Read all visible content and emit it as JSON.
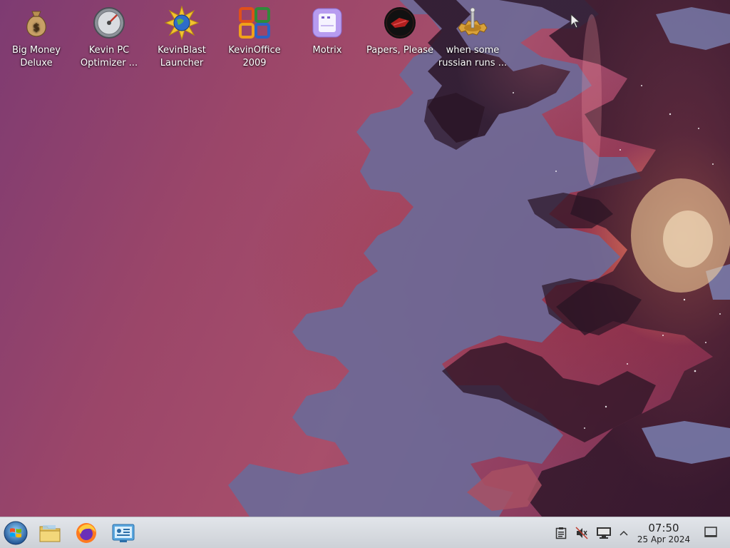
{
  "desktop": {
    "icons": [
      {
        "label": "Big Money\nDeluxe",
        "icon": "money-bag-icon"
      },
      {
        "label": "Kevin PC\nOptimizer ...",
        "icon": "speedometer-icon"
      },
      {
        "label": "KevinBlast\nLauncher",
        "icon": "globe-sun-icon"
      },
      {
        "label": "KevinOffice\n2009",
        "icon": "office-logo-icon"
      },
      {
        "label": "Motrix",
        "icon": "motrix-icon"
      },
      {
        "label": "Papers, Please",
        "icon": "papers-please-icon"
      },
      {
        "label": "when some\nrussian runs ...",
        "icon": "joystick-gear-icon"
      }
    ]
  },
  "taskbar": {
    "apps": [
      {
        "name": "start-menu",
        "icon": "windows-logo-icon"
      },
      {
        "name": "file-manager",
        "icon": "folder-icon"
      },
      {
        "name": "firefox",
        "icon": "firefox-icon"
      },
      {
        "name": "system-settings",
        "icon": "settings-panel-icon"
      }
    ],
    "tray": [
      {
        "name": "clipboard",
        "icon": "clipboard-icon"
      },
      {
        "name": "volume-muted",
        "icon": "speaker-muted-icon"
      },
      {
        "name": "display",
        "icon": "monitor-icon"
      },
      {
        "name": "expand-tray",
        "icon": "chevron-up-icon"
      }
    ],
    "clock": {
      "time": "07:50",
      "date": "25 Apr 2024"
    }
  }
}
